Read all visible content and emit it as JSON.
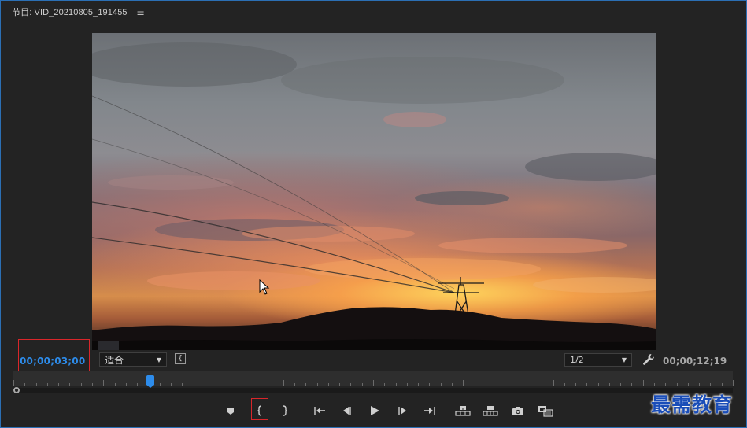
{
  "panel": {
    "title": "节目: VID_20210805_191455",
    "menu_icon": "hamburger-menu-icon"
  },
  "viewer": {
    "current_timecode": "00;00;03;00",
    "duration_timecode": "00;00;12;19",
    "zoom_fit_label": "适合",
    "resolution_label": "1/2",
    "playhead_position": 0.19
  },
  "transport": {
    "buttons": [
      {
        "name": "add-marker-button",
        "icon": "marker-icon"
      },
      {
        "name": "mark-in-button",
        "icon": "mark-in-icon"
      },
      {
        "name": "mark-out-button",
        "icon": "mark-out-icon"
      },
      {
        "name": "go-to-in-button",
        "icon": "go-to-in-icon"
      },
      {
        "name": "step-back-button",
        "icon": "step-back-icon"
      },
      {
        "name": "play-button",
        "icon": "play-icon"
      },
      {
        "name": "step-forward-button",
        "icon": "step-forward-icon"
      },
      {
        "name": "go-to-out-button",
        "icon": "go-to-out-icon"
      },
      {
        "name": "lift-button",
        "icon": "lift-icon"
      },
      {
        "name": "extract-button",
        "icon": "extract-icon"
      },
      {
        "name": "export-frame-button",
        "icon": "camera-icon"
      },
      {
        "name": "comparison-view-button",
        "icon": "comparison-icon"
      }
    ]
  },
  "watermark": {
    "text": "最需教育"
  },
  "colors": {
    "accent_blue": "#2d8ceb",
    "highlight_red": "#d9262a",
    "panel_border": "#2b6fb4"
  }
}
